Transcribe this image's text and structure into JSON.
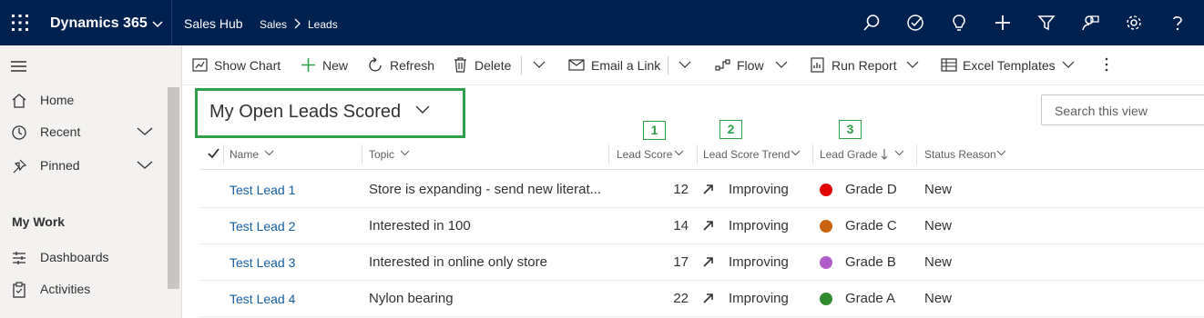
{
  "topbar": {
    "app_name": "Dynamics 365",
    "hub_name": "Sales Hub",
    "breadcrumb": [
      "Sales",
      "Leads"
    ]
  },
  "leftnav": {
    "items": [
      {
        "label": "Home",
        "icon": "home-icon"
      },
      {
        "label": "Recent",
        "icon": "clock-icon"
      },
      {
        "label": "Pinned",
        "icon": "pin-icon"
      }
    ],
    "section_title": "My Work",
    "work_items": [
      {
        "label": "Dashboards",
        "icon": "dashboard-icon"
      },
      {
        "label": "Activities",
        "icon": "clipboard-icon"
      }
    ]
  },
  "commands": {
    "show_chart": "Show Chart",
    "new": "New",
    "refresh": "Refresh",
    "delete": "Delete",
    "email_link": "Email a Link",
    "flow": "Flow",
    "run_report": "Run Report",
    "excel_templates": "Excel Templates"
  },
  "view": {
    "title": "My Open Leads Scored",
    "search_placeholder": "Search this view",
    "highlight_color": "#2e9e47"
  },
  "markers": [
    "1",
    "2",
    "3"
  ],
  "columns": [
    "Name",
    "Topic",
    "Lead Score",
    "Lead Score Trend",
    "Lead Grade",
    "Status Reason"
  ],
  "rows": [
    {
      "name": "Test Lead 1",
      "topic": "Store is expanding - send new literat...",
      "score": "12",
      "trend": "Improving",
      "grade": "Grade D",
      "grade_color": "#e00000",
      "status": "New"
    },
    {
      "name": "Test Lead 2",
      "topic": "Interested in 100",
      "score": "14",
      "trend": "Improving",
      "grade": "Grade C",
      "grade_color": "#c8620c",
      "status": "New"
    },
    {
      "name": "Test Lead 3",
      "topic": "Interested in online only store",
      "score": "17",
      "trend": "Improving",
      "grade": "Grade B",
      "grade_color": "#b05cc8",
      "status": "New"
    },
    {
      "name": "Test Lead 4",
      "topic": "Nylon bearing",
      "score": "22",
      "trend": "Improving",
      "grade": "Grade A",
      "grade_color": "#2e8b2e",
      "status": "New"
    }
  ]
}
